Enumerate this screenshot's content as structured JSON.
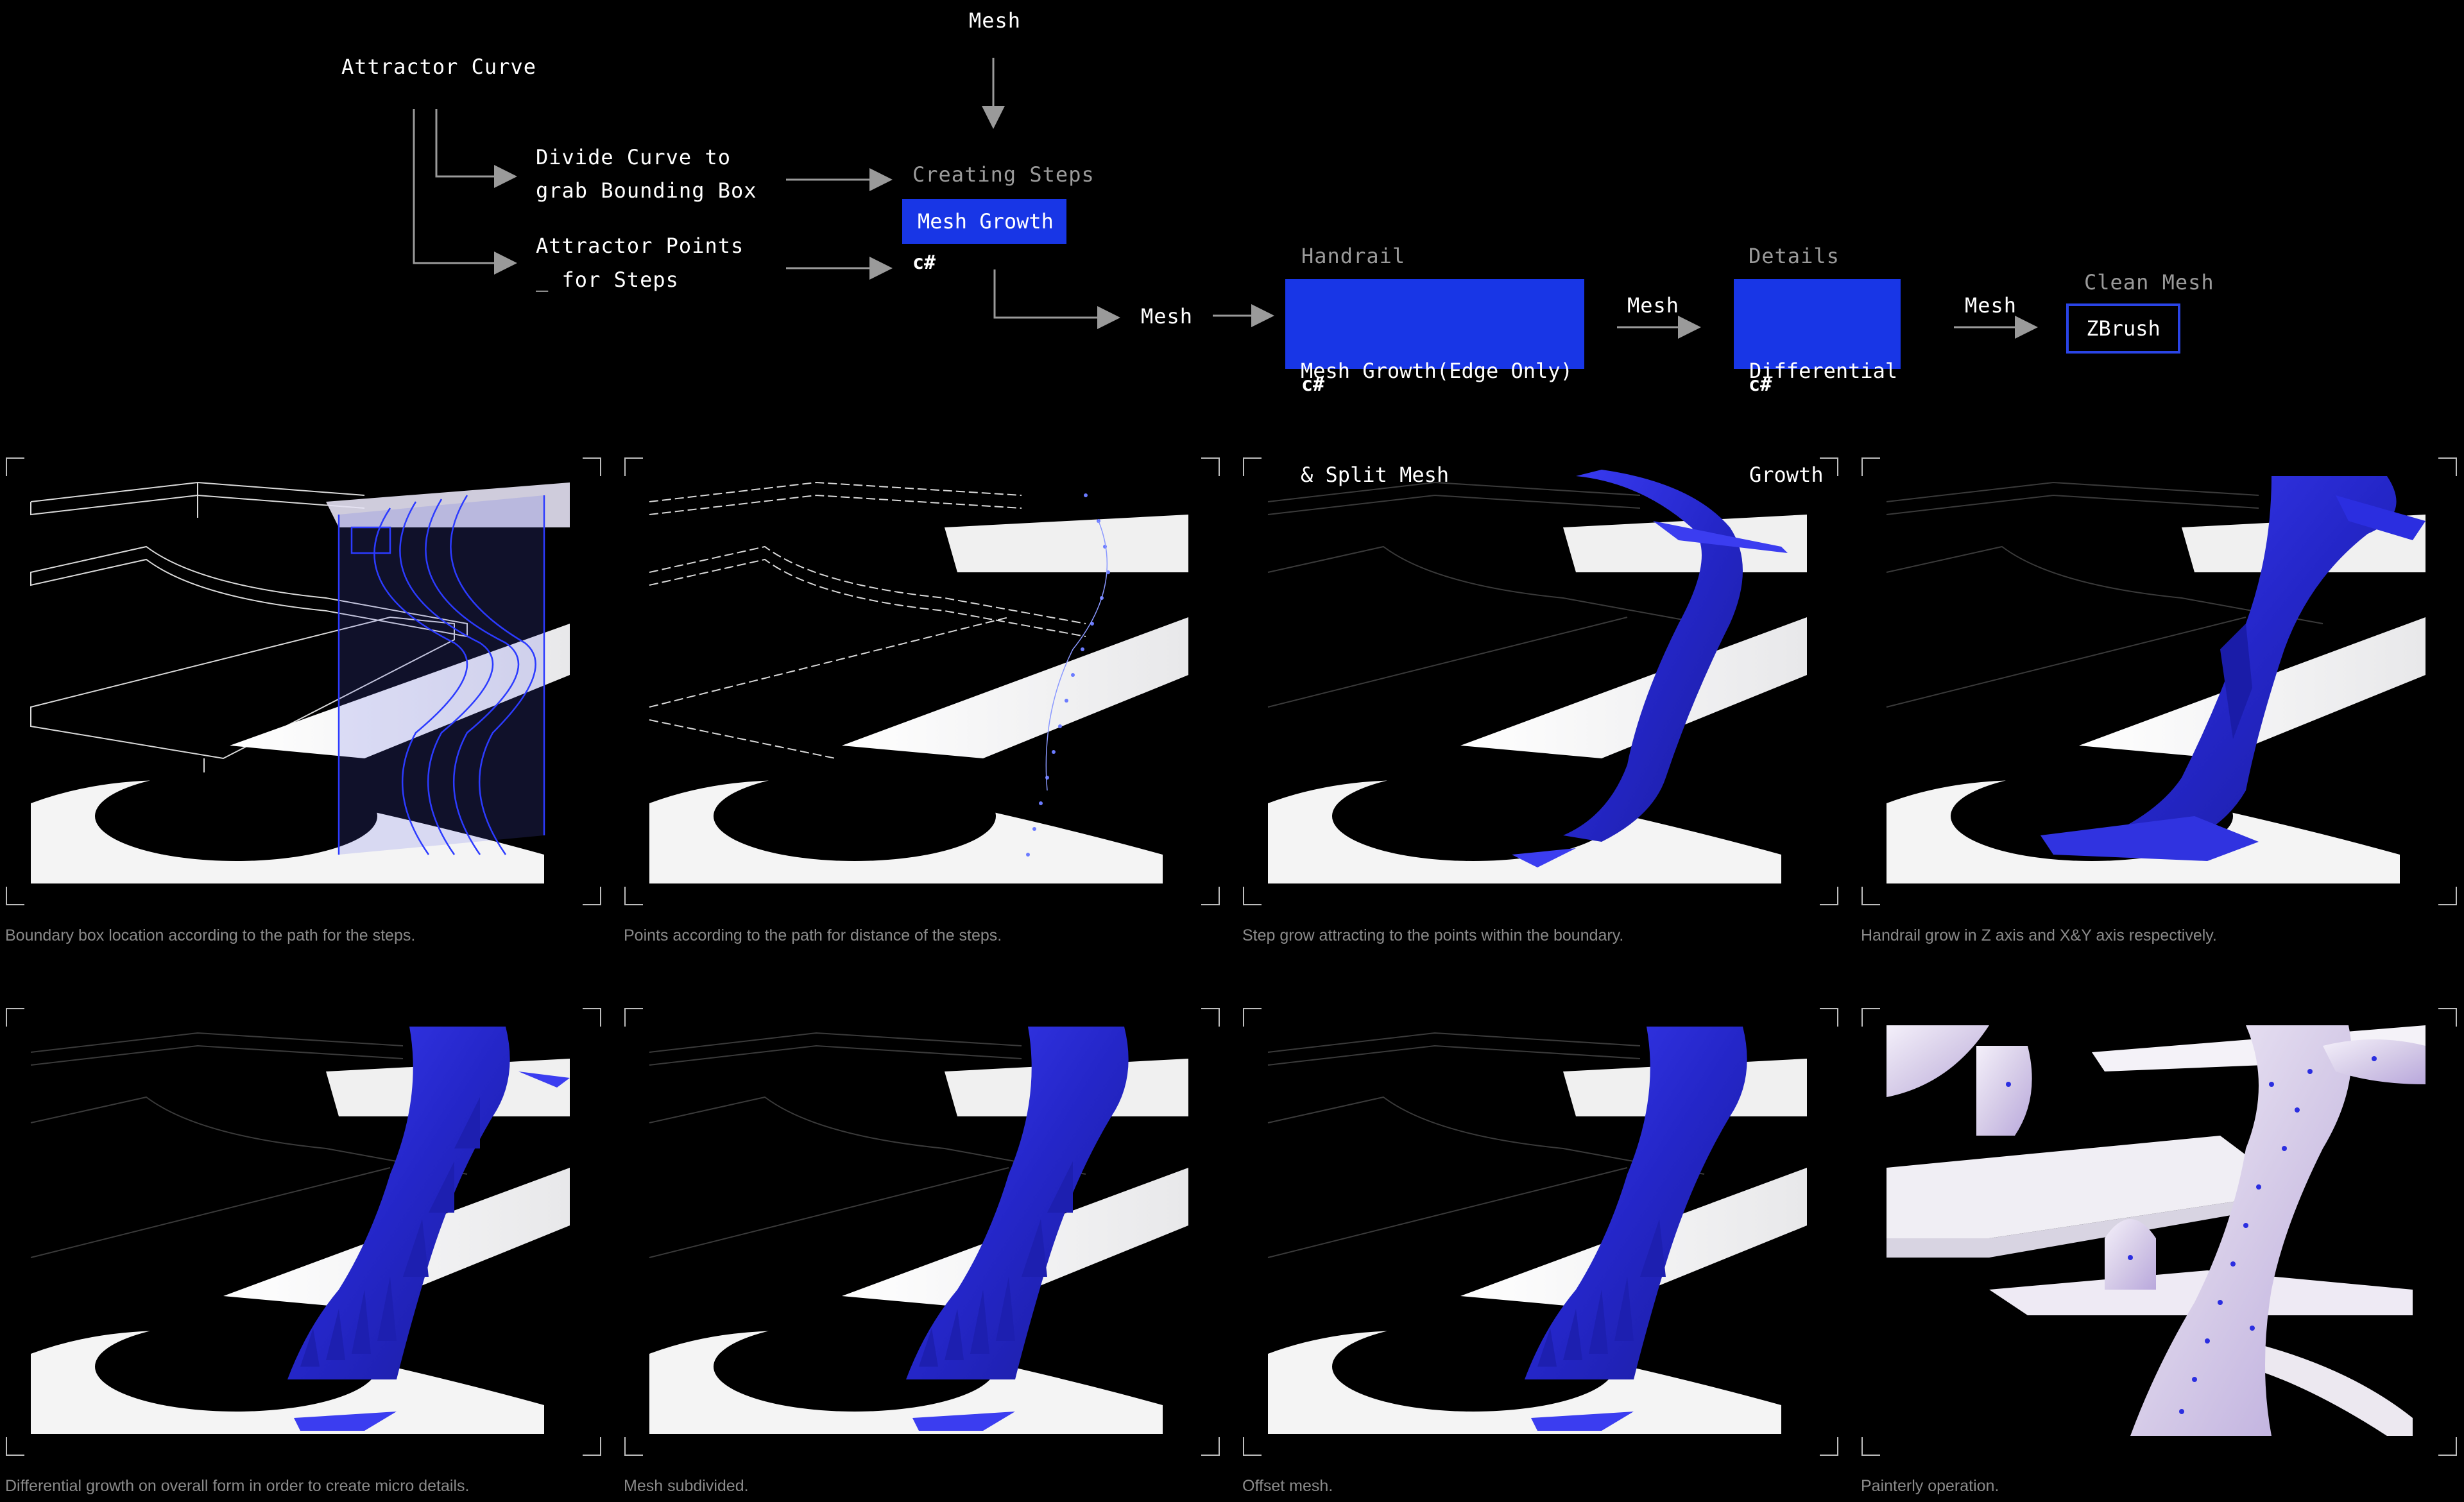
{
  "flow": {
    "attractor_curve": "Attractor Curve",
    "mesh_top": "Mesh",
    "divide_curve_line1": "Divide Curve to",
    "divide_curve_line2": "grab Bounding Box",
    "attractor_points_line1": "Attractor Points",
    "attractor_points_line2": "_ for Steps",
    "creating_steps_label": "Creating Steps",
    "mesh_growth_box": "Mesh Growth",
    "csharp_1": "c#",
    "mesh_mid": "Mesh",
    "handrail_label": "Handrail",
    "handrail_box_line1": "Mesh Growth(Edge Only)",
    "handrail_box_line2": "& Split Mesh",
    "csharp_2": "c#",
    "mesh_after_handrail": "Mesh",
    "details_label": "Details",
    "details_box_line1": "Differential",
    "details_box_line2": "Growth",
    "csharp_3": "c#",
    "mesh_after_details": "Mesh",
    "clean_mesh_label": "Clean Mesh",
    "zbrush_box": "ZBrush"
  },
  "panels": [
    {
      "caption": "Boundary box location according to the path for the steps."
    },
    {
      "caption": "Points according to the path for distance of the steps."
    },
    {
      "caption": "Step grow attracting to the points within the boundary."
    },
    {
      "caption": "Handrail grow in Z axis and X&Y axis respectively."
    },
    {
      "caption": "Differential growth on overall form in order to create micro details."
    },
    {
      "caption": "Mesh subdivided."
    },
    {
      "caption": "Offset mesh."
    },
    {
      "caption": "Painterly operation."
    }
  ],
  "colors": {
    "background": "#000000",
    "accent_blue": "#1836e6",
    "growth_blue": "#2b2ee0",
    "caption_gray": "#8a8a8a"
  }
}
